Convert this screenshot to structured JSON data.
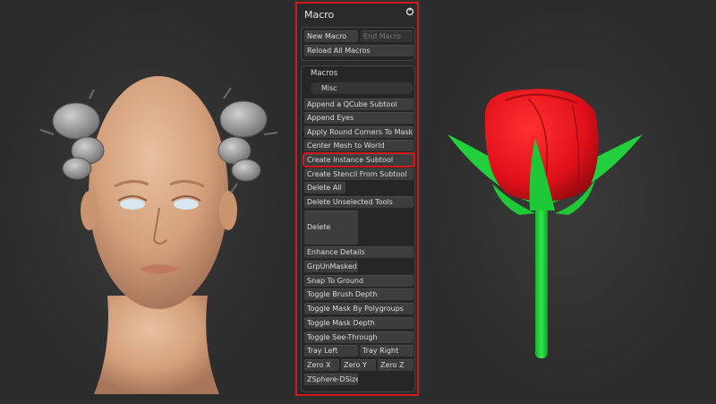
{
  "panel": {
    "title": "Macro",
    "icon": "refresh-icon"
  },
  "top_buttons": {
    "new_macro": "New Macro",
    "end_macro": "End Macro",
    "reload_all": "Reload All Macros"
  },
  "macros": {
    "header": "Macros",
    "misc": "Misc",
    "items": {
      "append_qcube": "Append a QCube Subtool",
      "append_eyes": "Append Eyes",
      "apply_round_corners": "Apply Round Corners To Mask",
      "center_mesh": "Center Mesh to World",
      "create_instance": "Create Instance Subtool",
      "create_stencil": "Create Stencil From Subtool",
      "delete_all": "Delete All",
      "delete_unselected": "Delete Unselected Tools",
      "delete": "Delete",
      "enhance_details": "Enhance Details",
      "grp_unmasked": "GrpUnMasked",
      "snap_to_ground": "Snap To Ground",
      "toggle_brush_depth": "Toggle Brush Depth",
      "toggle_mask_polygroups": "Toggle Mask By Polygroups",
      "toggle_mask_depth": "Toggle Mask Depth",
      "toggle_see_through": "Toggle See-Through",
      "tray_left": "Tray Left",
      "tray_right": "Tray Right",
      "zero_x": "Zero X",
      "zero_y": "Zero Y",
      "zero_z": "Zero Z",
      "zsphere_dsize": "ZSphere-DSize"
    }
  },
  "colors": {
    "highlight": "#d11a1a",
    "rose_red": "#e8121a",
    "stem_green": "#1fd63a",
    "skin": "#d9a882",
    "clay_gray": "#9a9a9a"
  }
}
